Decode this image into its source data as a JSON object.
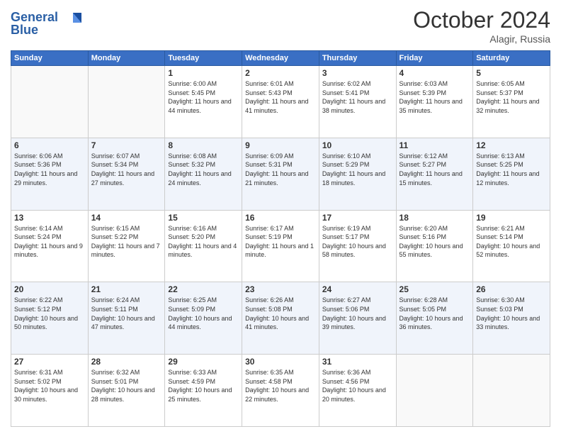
{
  "logo": {
    "line1": "General",
    "line2": "Blue"
  },
  "title": "October 2024",
  "subtitle": "Alagir, Russia",
  "days_header": [
    "Sunday",
    "Monday",
    "Tuesday",
    "Wednesday",
    "Thursday",
    "Friday",
    "Saturday"
  ],
  "weeks": [
    [
      {
        "num": "",
        "info": ""
      },
      {
        "num": "",
        "info": ""
      },
      {
        "num": "1",
        "info": "Sunrise: 6:00 AM\nSunset: 5:45 PM\nDaylight: 11 hours and 44 minutes."
      },
      {
        "num": "2",
        "info": "Sunrise: 6:01 AM\nSunset: 5:43 PM\nDaylight: 11 hours and 41 minutes."
      },
      {
        "num": "3",
        "info": "Sunrise: 6:02 AM\nSunset: 5:41 PM\nDaylight: 11 hours and 38 minutes."
      },
      {
        "num": "4",
        "info": "Sunrise: 6:03 AM\nSunset: 5:39 PM\nDaylight: 11 hours and 35 minutes."
      },
      {
        "num": "5",
        "info": "Sunrise: 6:05 AM\nSunset: 5:37 PM\nDaylight: 11 hours and 32 minutes."
      }
    ],
    [
      {
        "num": "6",
        "info": "Sunrise: 6:06 AM\nSunset: 5:36 PM\nDaylight: 11 hours and 29 minutes."
      },
      {
        "num": "7",
        "info": "Sunrise: 6:07 AM\nSunset: 5:34 PM\nDaylight: 11 hours and 27 minutes."
      },
      {
        "num": "8",
        "info": "Sunrise: 6:08 AM\nSunset: 5:32 PM\nDaylight: 11 hours and 24 minutes."
      },
      {
        "num": "9",
        "info": "Sunrise: 6:09 AM\nSunset: 5:31 PM\nDaylight: 11 hours and 21 minutes."
      },
      {
        "num": "10",
        "info": "Sunrise: 6:10 AM\nSunset: 5:29 PM\nDaylight: 11 hours and 18 minutes."
      },
      {
        "num": "11",
        "info": "Sunrise: 6:12 AM\nSunset: 5:27 PM\nDaylight: 11 hours and 15 minutes."
      },
      {
        "num": "12",
        "info": "Sunrise: 6:13 AM\nSunset: 5:25 PM\nDaylight: 11 hours and 12 minutes."
      }
    ],
    [
      {
        "num": "13",
        "info": "Sunrise: 6:14 AM\nSunset: 5:24 PM\nDaylight: 11 hours and 9 minutes."
      },
      {
        "num": "14",
        "info": "Sunrise: 6:15 AM\nSunset: 5:22 PM\nDaylight: 11 hours and 7 minutes."
      },
      {
        "num": "15",
        "info": "Sunrise: 6:16 AM\nSunset: 5:20 PM\nDaylight: 11 hours and 4 minutes."
      },
      {
        "num": "16",
        "info": "Sunrise: 6:17 AM\nSunset: 5:19 PM\nDaylight: 11 hours and 1 minute."
      },
      {
        "num": "17",
        "info": "Sunrise: 6:19 AM\nSunset: 5:17 PM\nDaylight: 10 hours and 58 minutes."
      },
      {
        "num": "18",
        "info": "Sunrise: 6:20 AM\nSunset: 5:16 PM\nDaylight: 10 hours and 55 minutes."
      },
      {
        "num": "19",
        "info": "Sunrise: 6:21 AM\nSunset: 5:14 PM\nDaylight: 10 hours and 52 minutes."
      }
    ],
    [
      {
        "num": "20",
        "info": "Sunrise: 6:22 AM\nSunset: 5:12 PM\nDaylight: 10 hours and 50 minutes."
      },
      {
        "num": "21",
        "info": "Sunrise: 6:24 AM\nSunset: 5:11 PM\nDaylight: 10 hours and 47 minutes."
      },
      {
        "num": "22",
        "info": "Sunrise: 6:25 AM\nSunset: 5:09 PM\nDaylight: 10 hours and 44 minutes."
      },
      {
        "num": "23",
        "info": "Sunrise: 6:26 AM\nSunset: 5:08 PM\nDaylight: 10 hours and 41 minutes."
      },
      {
        "num": "24",
        "info": "Sunrise: 6:27 AM\nSunset: 5:06 PM\nDaylight: 10 hours and 39 minutes."
      },
      {
        "num": "25",
        "info": "Sunrise: 6:28 AM\nSunset: 5:05 PM\nDaylight: 10 hours and 36 minutes."
      },
      {
        "num": "26",
        "info": "Sunrise: 6:30 AM\nSunset: 5:03 PM\nDaylight: 10 hours and 33 minutes."
      }
    ],
    [
      {
        "num": "27",
        "info": "Sunrise: 6:31 AM\nSunset: 5:02 PM\nDaylight: 10 hours and 30 minutes."
      },
      {
        "num": "28",
        "info": "Sunrise: 6:32 AM\nSunset: 5:01 PM\nDaylight: 10 hours and 28 minutes."
      },
      {
        "num": "29",
        "info": "Sunrise: 6:33 AM\nSunset: 4:59 PM\nDaylight: 10 hours and 25 minutes."
      },
      {
        "num": "30",
        "info": "Sunrise: 6:35 AM\nSunset: 4:58 PM\nDaylight: 10 hours and 22 minutes."
      },
      {
        "num": "31",
        "info": "Sunrise: 6:36 AM\nSunset: 4:56 PM\nDaylight: 10 hours and 20 minutes."
      },
      {
        "num": "",
        "info": ""
      },
      {
        "num": "",
        "info": ""
      }
    ]
  ]
}
